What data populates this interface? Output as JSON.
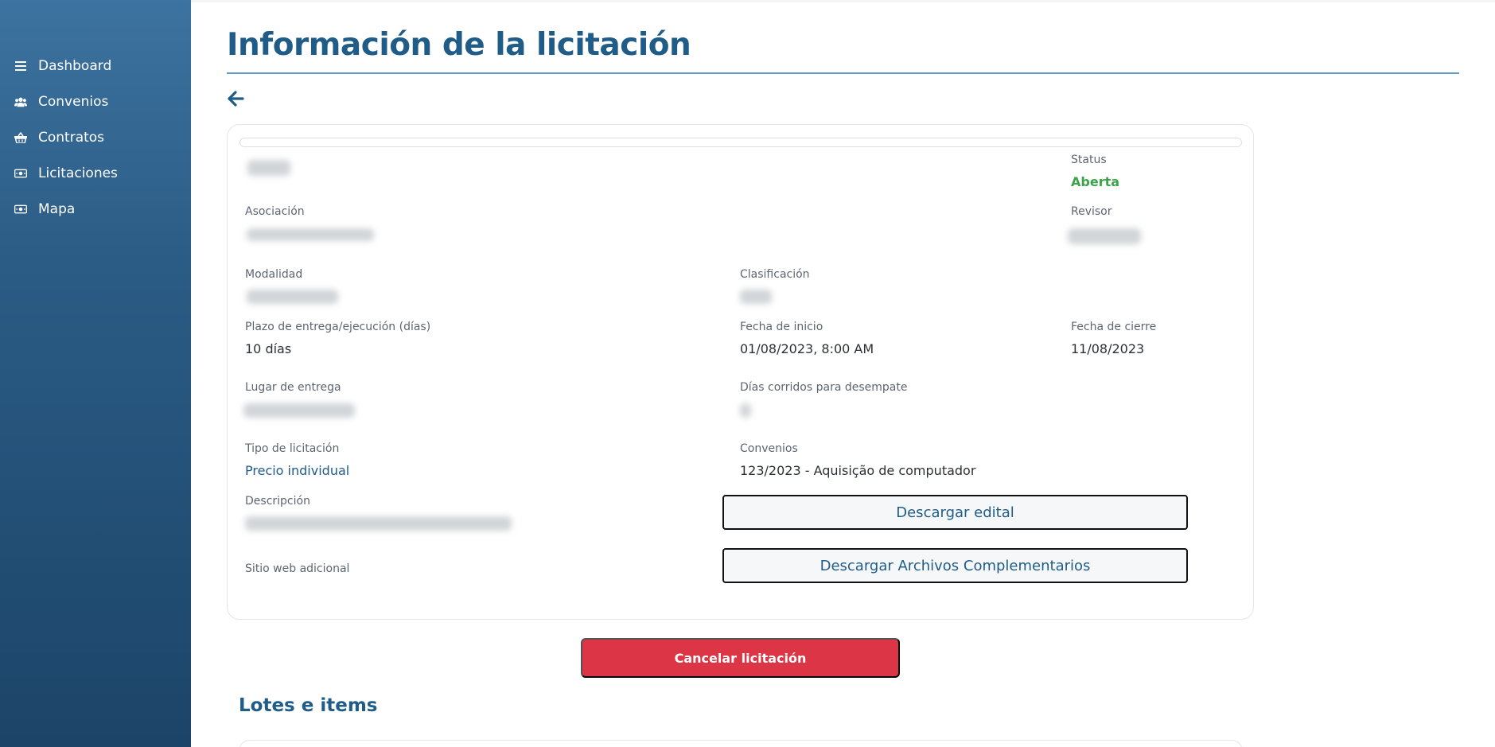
{
  "sidebar": {
    "items": [
      {
        "label": "Dashboard",
        "icon": "bars-icon"
      },
      {
        "label": "Convenios",
        "icon": "users-icon"
      },
      {
        "label": "Contratos",
        "icon": "basket-icon"
      },
      {
        "label": "Licitaciones",
        "icon": "money-bill-icon"
      },
      {
        "label": "Mapa",
        "icon": "money-bill-icon"
      }
    ]
  },
  "page": {
    "title": "Información de la licitación"
  },
  "details": {
    "progress_percent": 0,
    "status_label": "Status",
    "status_value": "Aberta",
    "asociacion_label": "Asociación",
    "revisor_label": "Revisor",
    "modalidad_label": "Modalidad",
    "clasificacion_label": "Clasificación",
    "plazo_label": "Plazo de entrega/ejecución (días)",
    "plazo_value": "10 días",
    "fecha_inicio_label": "Fecha de inicio",
    "fecha_inicio_value": "01/08/2023, 8:00 AM",
    "fecha_cierre_label": "Fecha de cierre",
    "fecha_cierre_value": "11/08/2023",
    "lugar_label": "Lugar de entrega",
    "dias_label": "Días corridos para desempate",
    "tipo_label": "Tipo de licitación",
    "tipo_value": "Precio individual",
    "convenios_label": "Convenios",
    "convenios_value": "123/2023 - Aquisição de computador",
    "descripcion_label": "Descripción",
    "sitio_label": "Sitio web adicional"
  },
  "buttons": {
    "descargar_edital": "Descargar edital",
    "descargar_archivos": "Descargar Archivos Complementarios",
    "cancelar": "Cancelar licitación"
  },
  "lotes": {
    "title": "Lotes e items"
  },
  "colors": {
    "primary": "#1f5c87",
    "accent_rule": "#5d9ccc",
    "status_green": "#3aa44a",
    "danger": "#dc3545"
  }
}
